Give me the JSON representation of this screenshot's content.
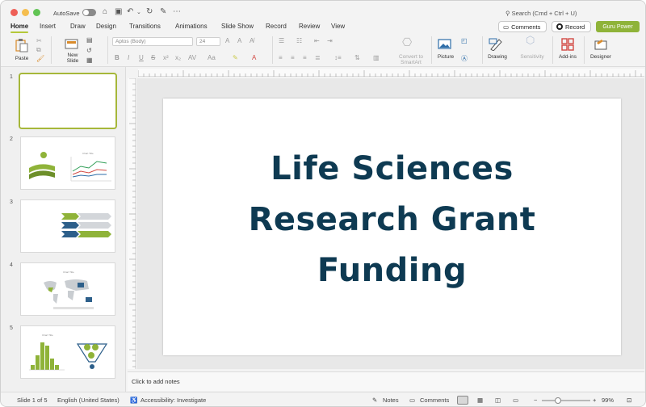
{
  "window": {
    "autosave_label": "AutoSave",
    "search_placeholder": "Search (Cmd + Ctrl + U)"
  },
  "ribbon_tabs": [
    "Home",
    "Insert",
    "Draw",
    "Design",
    "Transitions",
    "Animations",
    "Slide Show",
    "Record",
    "Review",
    "View"
  ],
  "top_buttons": {
    "comments": "Comments",
    "record": "Record",
    "guru": "Guru Power"
  },
  "ribbon": {
    "paste": "Paste",
    "new_slide": "New\nSlide",
    "font_name": "Aptos (Body)",
    "font_size": "24",
    "convert_smartart": "Convert to\nSmartArt",
    "picture": "Picture",
    "drawing": "Drawing",
    "sensitivity": "Sensitivity",
    "addins": "Add-ins",
    "designer": "Designer"
  },
  "thumbnails": [
    {
      "num": "1",
      "selected": true
    },
    {
      "num": "2",
      "selected": false,
      "chart_title": "Chart Title"
    },
    {
      "num": "3",
      "selected": false
    },
    {
      "num": "4",
      "selected": false,
      "chart_title": "Chart Title"
    },
    {
      "num": "5",
      "selected": false,
      "chart_title": "Chart Title"
    }
  ],
  "slide": {
    "title_line1": "Life Sciences",
    "title_line2": "Research Grant",
    "title_line3": "Funding"
  },
  "notes_placeholder": "Click to add notes",
  "status": {
    "slide_counter": "Slide 1 of 5",
    "language": "English (United States)",
    "accessibility": "Accessibility: Investigate",
    "notes": "Notes",
    "comments": "Comments",
    "zoom": "99%"
  },
  "colors": {
    "accent": "#8fb339",
    "title": "#0e3a52",
    "active_tab_underline": "#b5c83a"
  }
}
